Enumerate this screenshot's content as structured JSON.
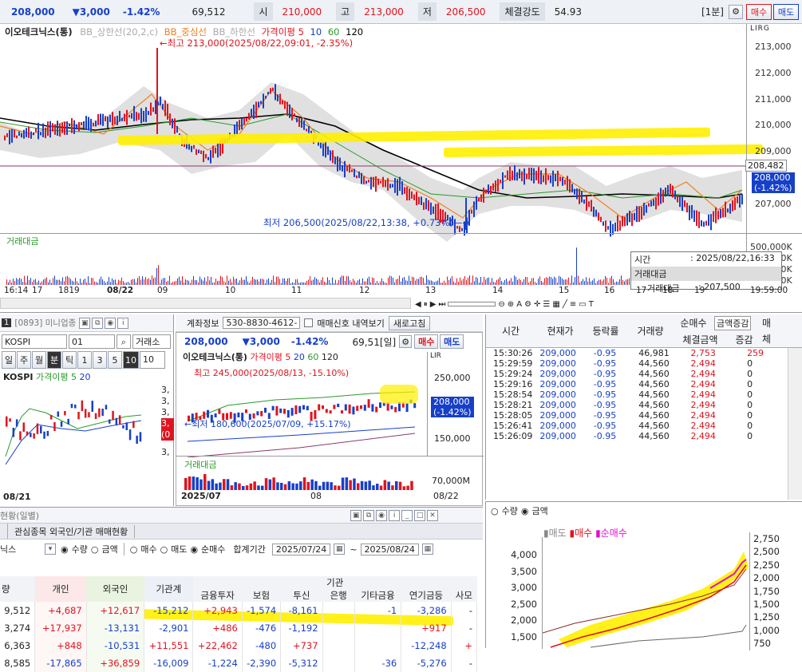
{
  "top": {
    "price": "208,000",
    "change": "▼3,000",
    "pct": "-1.42%",
    "volume": "69,512",
    "open_lbl": "시",
    "open": "210,000",
    "high_lbl": "고",
    "high": "213,000",
    "low_lbl": "저",
    "low": "206,500",
    "strength_lbl": "체결강도",
    "strength": "54.93",
    "period": "[1분]",
    "buy": "매수",
    "sell": "매도"
  },
  "chart": {
    "stock": "이오테크닉스(통)",
    "legend": [
      "BB_상한선(20,2,c)",
      "BB_중심선",
      "BB_하한선",
      "가격이평 5",
      "10",
      "60",
      "120"
    ],
    "high_note": "←최고 213,000(2025/08/22,09:01, -2.35%)",
    "low_note": "최저 206,500(2025/08/22,13:38, +0.73%)—→",
    "yaxis": [
      "213,000",
      "212,000",
      "211,000",
      "210,000",
      "209,000",
      "208,000",
      "207,000"
    ],
    "hline_tag": "208,482",
    "price_tag": "208,000",
    "price_tag2": "(-1.42%)",
    "vol_title": "거래대금",
    "vol_axis": [
      "500,000K",
      "400,000K",
      "300,000K",
      "200,000K",
      "100,000K"
    ],
    "tooltip": {
      "time_lbl": "시간",
      "time_val": ": 2025/08/22,16:33",
      "title": "거래대금",
      "val_lbl": "거래대금",
      "val": ": 207,500"
    },
    "xaxis": [
      "16:14",
      "17",
      "1819",
      "08/22",
      "09",
      "10",
      "11",
      "12",
      "13",
      "14",
      "15",
      "16",
      "17",
      "18",
      "19"
    ],
    "xend": "19:59:00",
    "lri": "LIRG"
  },
  "kospi": {
    "screen": "[0893] 미니업종",
    "code": "KOSPI",
    "num": "01",
    "exch": "거래소",
    "periods": [
      "일",
      "주",
      "월",
      "분",
      "틱",
      "1",
      "3",
      "5",
      "10"
    ],
    "sel": "10",
    "title": "KOSPI",
    "ma": "가격이평 5",
    "ma2": "20",
    "xdate": "08/21",
    "yside": [
      "3,",
      "3,",
      "3,",
      "3,",
      "3,"
    ],
    "tag1": "3,",
    "tag2": "(0"
  },
  "acct": {
    "lbl": "계좌정보",
    "acc": "530-8830-4612-",
    "chk": "매매신호 내역보기",
    "refresh": "새로고침"
  },
  "mini": {
    "price": "208,000",
    "change": "▼3,000",
    "pct": "-1.42%",
    "vol": "69,51[일]",
    "buy": "매수",
    "sell": "매도",
    "stock": "이오테크닉스(통)",
    "legend": [
      "가격이평 5",
      "20",
      "60",
      "120"
    ],
    "high_note": "최고 245,000(2025/08/13, -15.10%)",
    "low_note": "←최저 180,600(2025/07/09, +15.17%)",
    "yaxis": [
      "250,000",
      "200,000",
      "150,000"
    ],
    "tag": "208,000",
    "tag2": "(-1.42%)",
    "vol_title": "거래대금",
    "vol_axis": "70,000M",
    "xlabels": [
      "2025/07",
      "08",
      "08/22"
    ]
  },
  "trades": {
    "headers": [
      "시간",
      "현재가",
      "등락률",
      "거래량",
      "순매수",
      "체결금액",
      "증감",
      "매",
      "체"
    ],
    "sort": "금액증감",
    "rows": [
      [
        "15:30:26",
        "209,000",
        "-0.95",
        "46,981",
        "2,753",
        "259"
      ],
      [
        "15:29:59",
        "209,000",
        "-0.95",
        "44,560",
        "2,494",
        "0"
      ],
      [
        "15:29:24",
        "209,000",
        "-0.95",
        "44,560",
        "2,494",
        "0"
      ],
      [
        "15:29:16",
        "209,000",
        "-0.95",
        "44,560",
        "2,494",
        "0"
      ],
      [
        "15:28:54",
        "209,000",
        "-0.95",
        "44,560",
        "2,494",
        "0"
      ],
      [
        "15:28:21",
        "209,000",
        "-0.95",
        "44,560",
        "2,494",
        "0"
      ],
      [
        "15:28:05",
        "209,000",
        "-0.95",
        "44,560",
        "2,494",
        "0"
      ],
      [
        "15:26:41",
        "209,000",
        "-0.95",
        "44,560",
        "2,494",
        "0"
      ],
      [
        "15:26:09",
        "209,000",
        "-0.95",
        "44,560",
        "2,494",
        "0"
      ]
    ]
  },
  "net": {
    "r1": "수량",
    "r2": "금액",
    "legend": [
      "매도",
      "매수",
      "순매수"
    ],
    "yaxis": [
      "4,000",
      "3,500",
      "3,000",
      "2,500",
      "2,000",
      "1,500"
    ],
    "yaxis_r": [
      "2,750",
      "2,500",
      "2,250",
      "2,000",
      "1,750",
      "1,500",
      "1,250",
      "1,000",
      "750"
    ]
  },
  "inv": {
    "title": "현황(일별)",
    "tabs": [
      "관심종목 외국인/기관 매매현황"
    ],
    "stock": "닉스",
    "r_qty": "수량",
    "r_amt": "금액",
    "r_buy": "매수",
    "r_sell": "매도",
    "r_net": "순매수",
    "period_lbl": "합계기간",
    "from": "2025/07/24",
    "to": "2025/08/24",
    "h_top": "기관",
    "headers": [
      "량",
      "개인",
      "외국인",
      "기관계",
      "금융투자",
      "보험",
      "투신",
      "은행",
      "기타금융",
      "연기금등",
      "사모"
    ],
    "rows": [
      [
        "9,512",
        "+4,687",
        "+12,617",
        "-15,212",
        "+2,943",
        "-1,574",
        "-8,161",
        "",
        "-1",
        "-3,286",
        "-"
      ],
      [
        "3,274",
        "+17,937",
        "-13,131",
        "-2,901",
        "+486",
        "-476",
        "-1,192",
        "",
        "",
        "+917",
        "-"
      ],
      [
        "6,363",
        "+848",
        "-10,531",
        "+11,551",
        "+22,462",
        "-480",
        "+737",
        "",
        "",
        "-12,248",
        "+"
      ],
      [
        "8,585",
        "-17,865",
        "+36,859",
        "-16,009",
        "-1,224",
        "-2,390",
        "-5,312",
        "",
        "-36",
        "-5,276",
        "-"
      ]
    ]
  }
}
